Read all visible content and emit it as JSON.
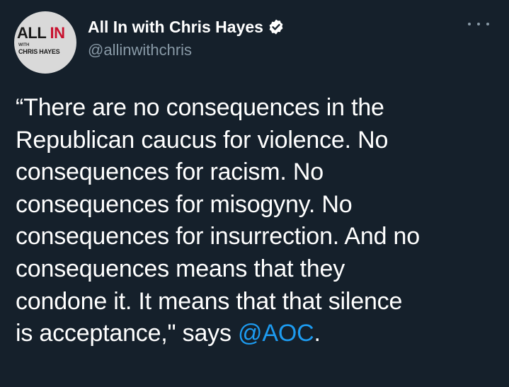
{
  "account": {
    "display_name": "All In with Chris Hayes",
    "handle": "@allinwithchris",
    "avatar_logo": {
      "word1": "ALL",
      "word2": "IN",
      "small": "WITH",
      "name": "CHRIS HAYES"
    }
  },
  "tweet": {
    "text_lines": [
      "“There are no consequences in the",
      "Republican caucus for violence. No",
      "consequences for racism. No",
      "consequences for misogyny. No",
      "consequences for insurrection. And no",
      "consequences means that they",
      "condone it. It means that that silence",
      "is acceptance,\" says "
    ],
    "mention": "@AOC",
    "ending": "."
  },
  "icons": {
    "verified": "verified-badge-icon",
    "more": "more-options-icon"
  },
  "colors": {
    "background": "#15202b",
    "text": "#ffffff",
    "secondary": "#8899a6",
    "link": "#1d9bf0",
    "logo_red": "#c8102e"
  }
}
